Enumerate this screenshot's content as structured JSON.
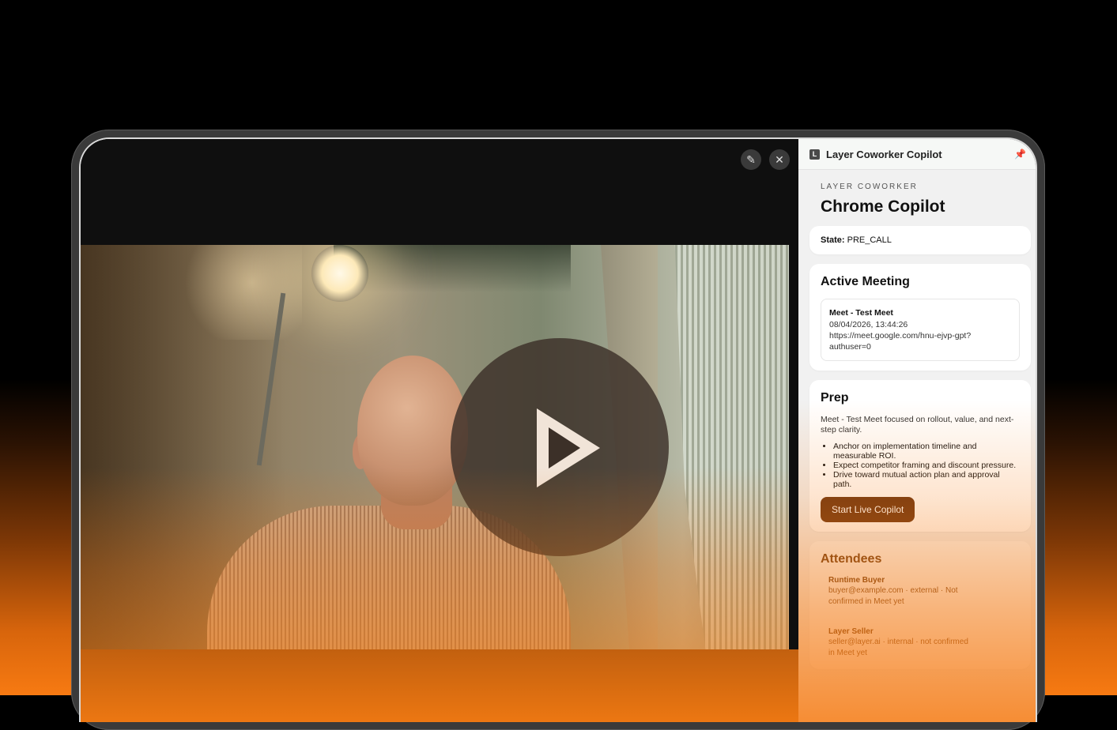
{
  "toolbar": {
    "edit_icon": "pen-sparkle-icon",
    "unpin_icon": "pin-off-icon"
  },
  "video": {
    "play_icon": "play-icon"
  },
  "panel": {
    "logo_letter": "L",
    "title": "Layer Coworker Copilot",
    "pin_icon": "pin-icon",
    "eyebrow": "LAYER COWORKER",
    "heading": "Chrome Copilot",
    "state_label": "State:",
    "state_value": "PRE_CALL",
    "active_meeting": {
      "heading": "Active Meeting",
      "title": "Meet - Test Meet",
      "datetime": "08/04/2026, 13:44:26",
      "url_line1": "https://meet.google.com/hnu-ejvp-gpt?",
      "url_line2": "authuser=0"
    },
    "prep": {
      "heading": "Prep",
      "summary": "Meet - Test Meet focused on rollout, value, and next-step clarity.",
      "bullets": [
        "Anchor on implementation timeline and measurable ROI.",
        "Expect competitor framing and discount pressure.",
        "Drive toward mutual action plan and approval path."
      ],
      "button": "Start Live Copilot"
    },
    "attendees": {
      "heading": "Attendees",
      "list": [
        {
          "name": "Runtime Buyer",
          "info_line1": "buyer@example.com · external · Not",
          "info_line2": "confirmed in Meet yet"
        },
        {
          "name": "Layer Seller",
          "info_line1": "seller@layer.ai · internal · not confirmed",
          "info_line2": "in Meet yet"
        }
      ]
    }
  },
  "colors": {
    "accent": "#6a3310",
    "glow": "#f77a12"
  }
}
